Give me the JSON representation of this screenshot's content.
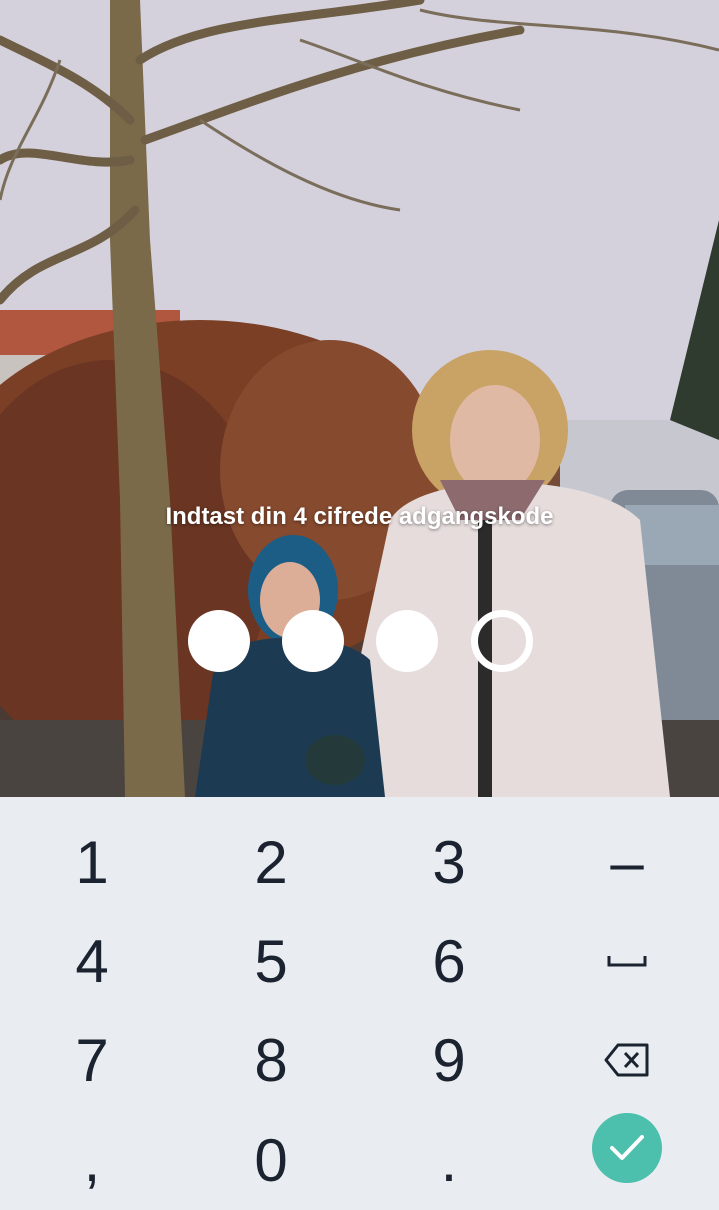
{
  "prompt": "Indtast din 4 cifrede adgangskode",
  "pin": {
    "length": 4,
    "entered": 3
  },
  "keys": {
    "k1": "1",
    "k2": "2",
    "k3": "3",
    "minus": "–",
    "k4": "4",
    "k5": "5",
    "k6": "6",
    "space": "space-icon",
    "k7": "7",
    "k8": "8",
    "k9": "9",
    "backspace": "backspace-icon",
    "comma": ",",
    "k0": "0",
    "period": ".",
    "confirm": "checkmark-icon"
  },
  "colors": {
    "keypad_bg": "#e9edf1",
    "key_text": "#1b2230",
    "confirm_bg": "#4cbfad",
    "pin_dot": "#ffffff"
  }
}
